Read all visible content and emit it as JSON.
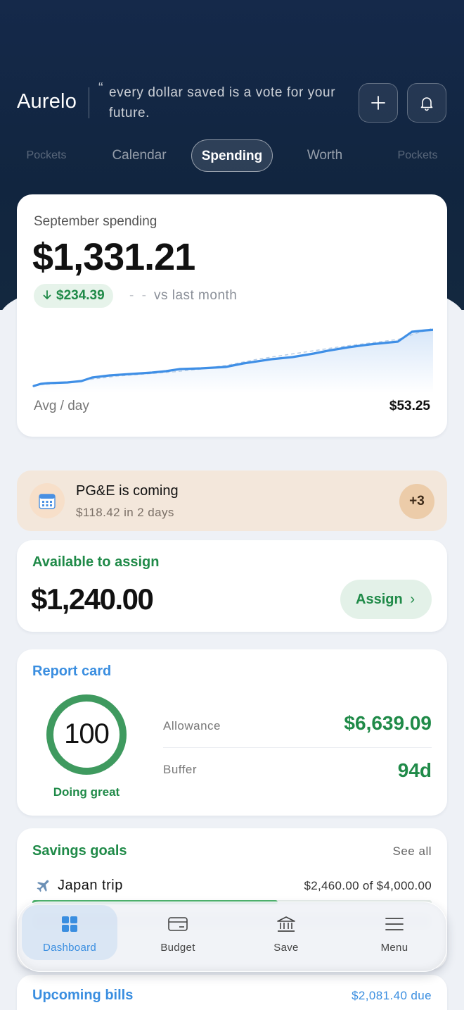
{
  "header": {
    "brand": "Aurelo",
    "quote_mark": "“",
    "tagline": "every dollar saved is a vote for your future.",
    "add_icon": "plus-icon",
    "notifications_icon": "bell-icon"
  },
  "tabs": [
    {
      "label": "Pockets"
    },
    {
      "label": "Calendar"
    },
    {
      "label": "Spending",
      "active": true
    },
    {
      "label": "Worth"
    },
    {
      "label": "Pockets"
    }
  ],
  "spending": {
    "label": "September spending",
    "amount": "$1,331.21",
    "delta_icon": "arrow-down-icon",
    "delta": "$234.39",
    "vs_text": "vs last month",
    "avg_label": "Avg / day",
    "avg_value": "$53.25"
  },
  "bill_alert": {
    "icon": "calendar-icon",
    "title": "PG&E is coming",
    "subtitle": "$118.42 in 2 days",
    "more": "+3"
  },
  "assign": {
    "label": "Available to assign",
    "amount": "$1,240.00",
    "button": "Assign",
    "chevron": "›"
  },
  "report": {
    "label": "Report card",
    "score": "100",
    "score_max": 100,
    "caption": "Doing great",
    "stats": [
      {
        "label": "Allowance",
        "value": "$6,639.09"
      },
      {
        "label": "Buffer",
        "value": "94d"
      }
    ]
  },
  "goals": {
    "label": "Savings goals",
    "see_all": "See all",
    "items": [
      {
        "icon": "airplane-icon",
        "name": "Japan trip",
        "amount": "$2,460.00 of $4,000.00",
        "progress": 0.615
      }
    ]
  },
  "bills": {
    "label": "Upcoming bills",
    "due": "$2,081.40 due"
  },
  "nav": [
    {
      "label": "Dashboard",
      "icon": "grid-icon",
      "active": true
    },
    {
      "label": "Budget",
      "icon": "card-icon"
    },
    {
      "label": "Save",
      "icon": "bank-icon"
    },
    {
      "label": "Menu",
      "icon": "menu-icon"
    }
  ],
  "colors": {
    "header_bg": "#15294a",
    "accent_green": "#1f8a48",
    "accent_blue": "#3a8ee0",
    "bill_bg": "#f3e7db"
  }
}
